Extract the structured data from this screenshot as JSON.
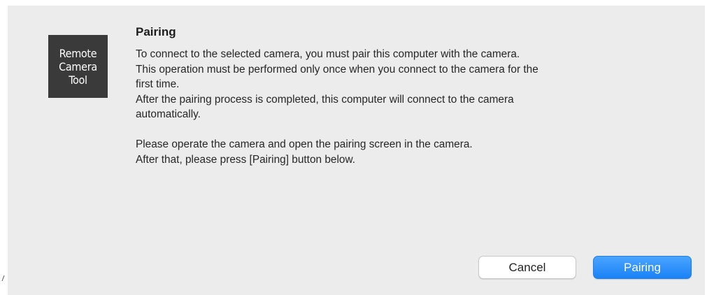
{
  "app_icon": {
    "lines": [
      "Remote",
      "Camera",
      "Tool"
    ]
  },
  "dialog": {
    "title": "Pairing",
    "message_lines": [
      "To connect to the selected camera, you must pair this computer with the camera.",
      "This operation must be performed only once when you connect to the camera for the",
      "first time.",
      "After the pairing process is completed, this computer will connect to the camera",
      "automatically."
    ],
    "instruction_lines": [
      "Please operate the camera and open the pairing screen in the camera.",
      "After that, please press [Pairing] button below."
    ]
  },
  "buttons": {
    "cancel_label": "Cancel",
    "pairing_label": "Pairing"
  },
  "colors": {
    "dialog_background": "#ececec",
    "primary_button": "#1a82f7",
    "icon_background": "#3a3a3a"
  }
}
